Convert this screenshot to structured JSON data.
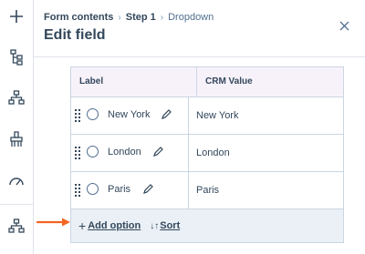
{
  "breadcrumb": {
    "items": [
      "Form contents",
      "Step 1",
      "Dropdown"
    ],
    "separator": "›"
  },
  "panel": {
    "title": "Edit field"
  },
  "table": {
    "columns": [
      "Label",
      "CRM Value"
    ],
    "rows": [
      {
        "label": "New York",
        "crm_value": "New York"
      },
      {
        "label": "London",
        "crm_value": "London"
      },
      {
        "label": "Paris",
        "crm_value": "Paris"
      }
    ],
    "footer": {
      "add_option_icon": "+",
      "add_option_label": "Add option",
      "sort_icon": "↓↑",
      "sort_label": "Sort"
    }
  },
  "rail": {
    "icons": [
      "plus-icon",
      "tree-icon",
      "sitemap-icon",
      "brush-icon",
      "gauge-icon",
      "org-chart-icon"
    ]
  },
  "colors": {
    "annotation_arrow": "#f26522",
    "header_bg": "#f7f2fa",
    "footer_bg": "#eaf0f6",
    "text": "#33475b"
  }
}
